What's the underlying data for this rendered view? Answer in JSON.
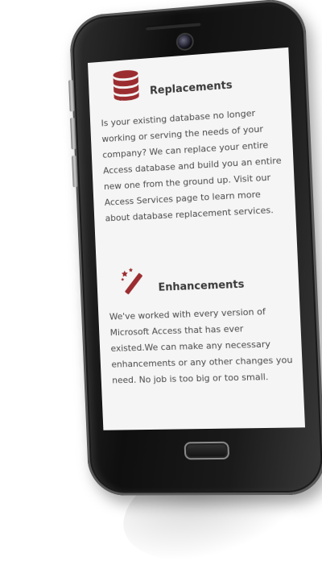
{
  "colors": {
    "accent": "#9b2d30",
    "text": "#4a4a4a",
    "heading": "#3a3a3a",
    "screen_bg": "#f5f5f5"
  },
  "sections": [
    {
      "icon": "database-icon",
      "title": "Replacements",
      "body": "Is your existing database no longer working or serving the needs of your company? We can replace your entire Access database and build you an entire new one from the ground up. Visit our Access Services page to learn more about database replacement services."
    },
    {
      "icon": "magic-wand-icon",
      "title": "Enhancements",
      "body": "We've worked with every version of Microsoft Access that has ever existed.We can make any necessary enhancements or any other changes you need. No job is too big or too small."
    }
  ]
}
